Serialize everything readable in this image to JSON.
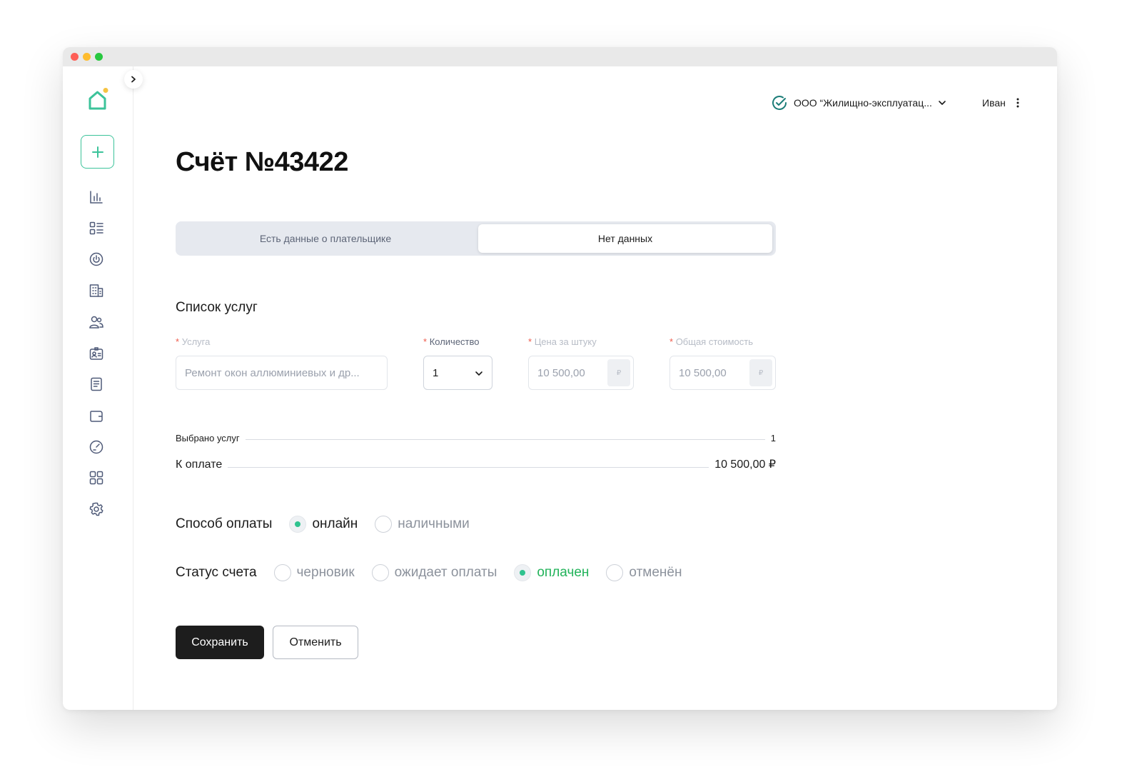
{
  "header": {
    "org_name": "ООО “Жилищно-эксплуатац...",
    "user_name": "Иван"
  },
  "page": {
    "title": "Счёт №43422"
  },
  "tabs": [
    {
      "label": "Есть данные о плательщике",
      "selected": false
    },
    {
      "label": "Нет данных",
      "selected": true
    }
  ],
  "services": {
    "title": "Список услуг",
    "required_mark": "*",
    "fields": {
      "service_label": "Услуга",
      "service_value": "Ремонт окон аллюминиевых и др...",
      "quantity_label": "Количество",
      "quantity_value": "1",
      "unit_price_label": "Цена за штуку",
      "unit_price_value": "10 500,00",
      "total_label": "Общая стоимость",
      "total_value": "10 500,00",
      "currency": "₽"
    }
  },
  "summary": {
    "selected_label": "Выбрано услуг",
    "selected_value": "1",
    "to_pay_label": "К оплате",
    "to_pay_value": "10 500,00 ₽"
  },
  "payment_method": {
    "label": "Способ оплаты",
    "options": [
      {
        "label": "онлайн",
        "checked": true
      },
      {
        "label": "наличными",
        "checked": false
      }
    ]
  },
  "invoice_status": {
    "label": "Статус счета",
    "options": [
      {
        "label": "черновик",
        "checked": false
      },
      {
        "label": "ожидает оплаты",
        "checked": false
      },
      {
        "label": "оплачен",
        "checked": true
      },
      {
        "label": "отменён",
        "checked": false
      }
    ]
  },
  "actions": {
    "save": "Сохранить",
    "cancel": "Отменить"
  },
  "sidebar": {
    "icons": [
      "analytics-icon",
      "list-icon",
      "power-icon",
      "building-icon",
      "users-icon",
      "id-card-icon",
      "document-icon",
      "wallet-icon",
      "speedometer-icon",
      "apps-icon",
      "settings-icon"
    ]
  },
  "colors": {
    "accent": "#2fc38f",
    "paid_status": "#22b35a",
    "required": "#ef5b4c",
    "primary_button": "#1d1d1d"
  }
}
